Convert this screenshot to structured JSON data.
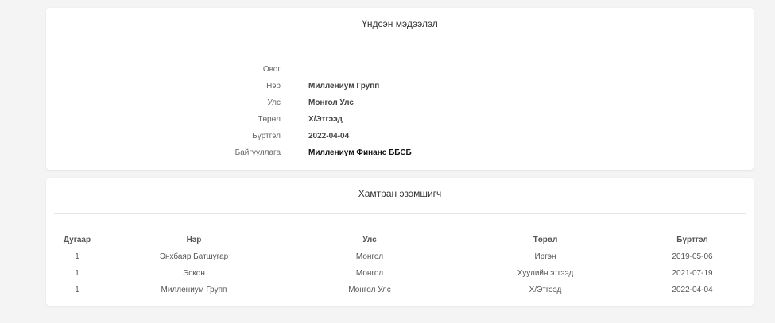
{
  "basic_info": {
    "title": "Үндсэн мэдээлэл",
    "rows": [
      {
        "label": "Овог",
        "value": ""
      },
      {
        "label": "Нэр",
        "value": "Миллениум Групп"
      },
      {
        "label": "Улс",
        "value": "Монгол Улс"
      },
      {
        "label": "Төрөл",
        "value": "Х/Этгээд"
      },
      {
        "label": "Бүртгэл",
        "value": "2022-04-04"
      },
      {
        "label": "Байгууллага",
        "value": "Миллениум Финанс ББСБ"
      }
    ]
  },
  "co_owners": {
    "title": "Хамтран эзэмшигч",
    "headers": [
      "Дугаар",
      "Нэр",
      "Улс",
      "Төрөл",
      "Бүртгэл"
    ],
    "rows": [
      [
        "1",
        "Энхбаяр Батшугар",
        "Монгол",
        "Иргэн",
        "2019-05-06"
      ],
      [
        "1",
        "Эскон",
        "Монгол",
        "Хуулийн этгээд",
        "2021-07-19"
      ],
      [
        "1",
        "Миллениум Групп",
        "Монгол Улс",
        "Х/Этгээд",
        "2022-04-04"
      ]
    ]
  }
}
